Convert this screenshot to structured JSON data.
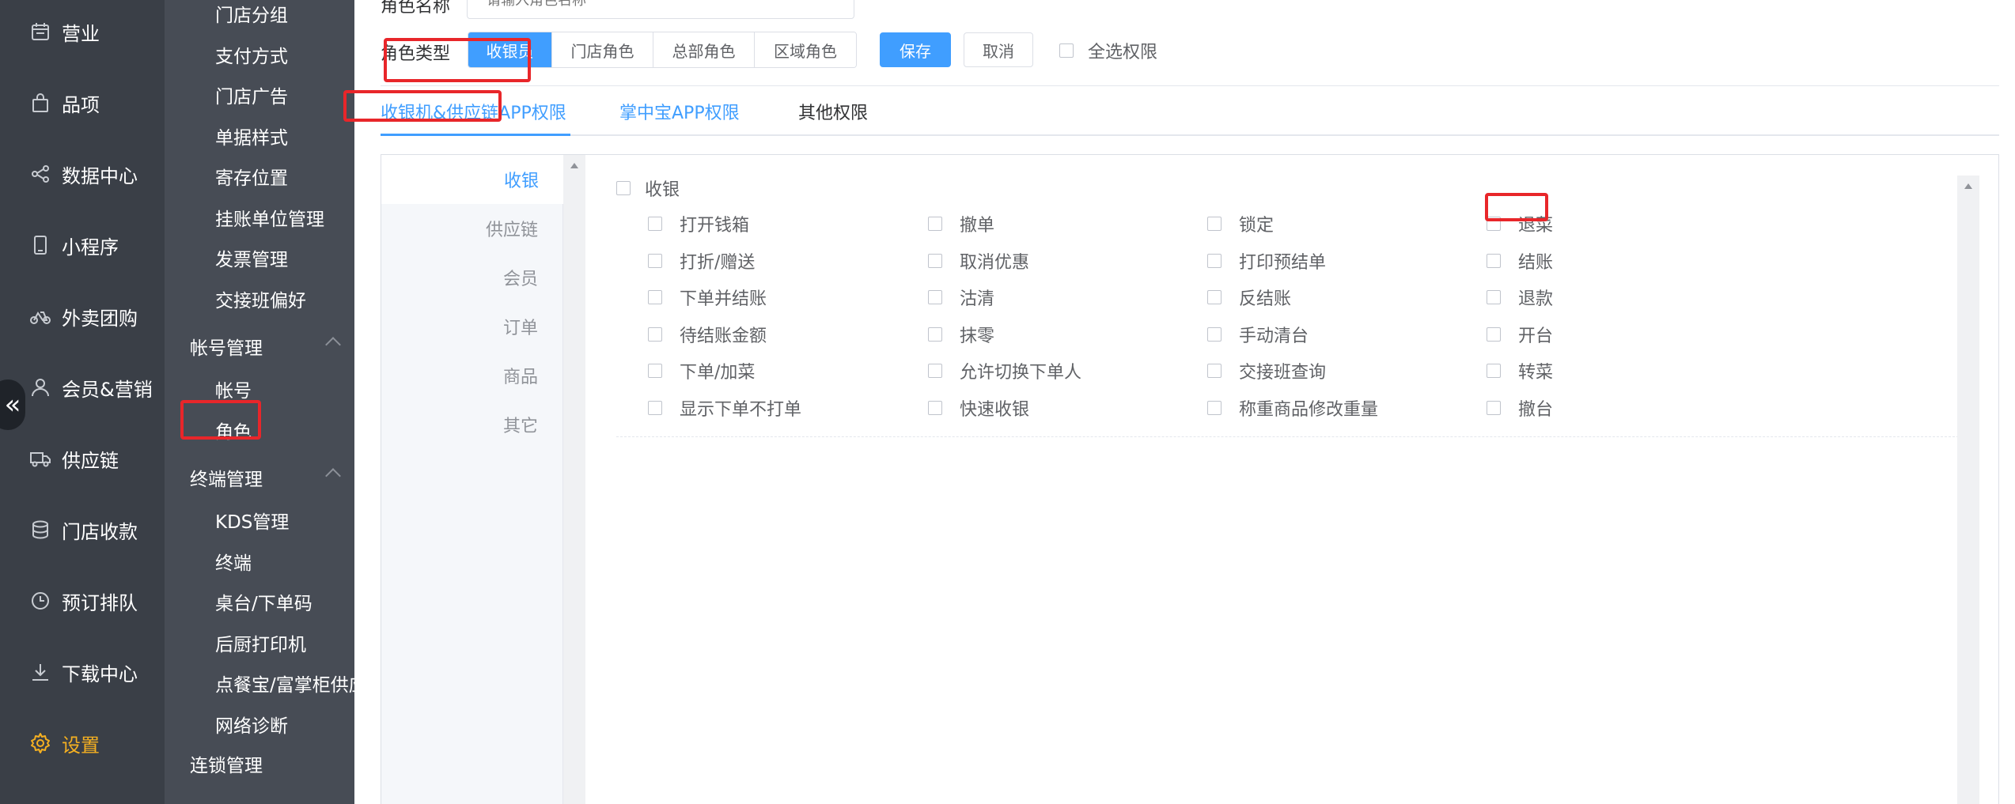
{
  "nav": {
    "items": [
      {
        "label": "营业",
        "icon": "calendar-icon"
      },
      {
        "label": "品项",
        "icon": "bag-icon"
      },
      {
        "label": "数据中心",
        "icon": "share-icon"
      },
      {
        "label": "小程序",
        "icon": "tablet-icon"
      },
      {
        "label": "外卖团购",
        "icon": "bike-icon"
      },
      {
        "label": "会员&营销",
        "icon": "user-icon"
      },
      {
        "label": "供应链",
        "icon": "truck-icon"
      },
      {
        "label": "门店收款",
        "icon": "database-icon"
      },
      {
        "label": "预订排队",
        "icon": "clock-icon"
      },
      {
        "label": "下载中心",
        "icon": "download-icon"
      },
      {
        "label": "设置",
        "icon": "gear-icon"
      },
      {
        "label": "",
        "icon": "partial-icon"
      }
    ],
    "active": "设置",
    "collapse_symbol": "«",
    "active_color": "#f5b021"
  },
  "submenu": {
    "items_top": [
      "门店分组",
      "支付方式",
      "门店广告",
      "单据样式",
      "寄存位置",
      "挂账单位管理",
      "发票管理",
      "交接班偏好"
    ],
    "group_account": "帐号管理",
    "account_items": [
      "帐号",
      "角色"
    ],
    "group_terminal": "终端管理",
    "terminal_items": [
      "KDS管理",
      "终端",
      "桌台/下单码",
      "后厨打印机",
      "点餐宝/富掌柜供应",
      "网络诊断"
    ],
    "group_chain": "连锁管理"
  },
  "form": {
    "name_label": "角色名称",
    "name_placeholder": "请输入角色名称",
    "type_label": "角色类型",
    "type_options": [
      "收银员",
      "门店角色",
      "总部角色",
      "区域角色"
    ],
    "type_selected": "收银员",
    "save_label": "保存",
    "cancel_label": "取消",
    "select_all_label": "全选权限"
  },
  "tabs": [
    "收银机&供应链APP权限",
    "掌中宝APP权限",
    "其他权限"
  ],
  "vertical_tabs": [
    "收银",
    "供应链",
    "会员",
    "订单",
    "商品",
    "其它"
  ],
  "permissions": {
    "group_label": "收银",
    "rows": [
      [
        "打开钱箱",
        "撤单",
        "锁定",
        "退菜"
      ],
      [
        "打折/赠送",
        "取消优惠",
        "打印预结单",
        "结账"
      ],
      [
        "下单并结账",
        "沽清",
        "反结账",
        "退款"
      ],
      [
        "待结账金额",
        "抹零",
        "手动清台",
        "开台"
      ],
      [
        "下单/加菜",
        "允许切换下单人",
        "交接班查询",
        "转菜"
      ],
      [
        "显示下单不打单",
        "快速收银",
        "称重商品修改重量",
        "撤台"
      ]
    ]
  },
  "colors": {
    "primary": "#409eff",
    "highlight": "#e8262a"
  }
}
